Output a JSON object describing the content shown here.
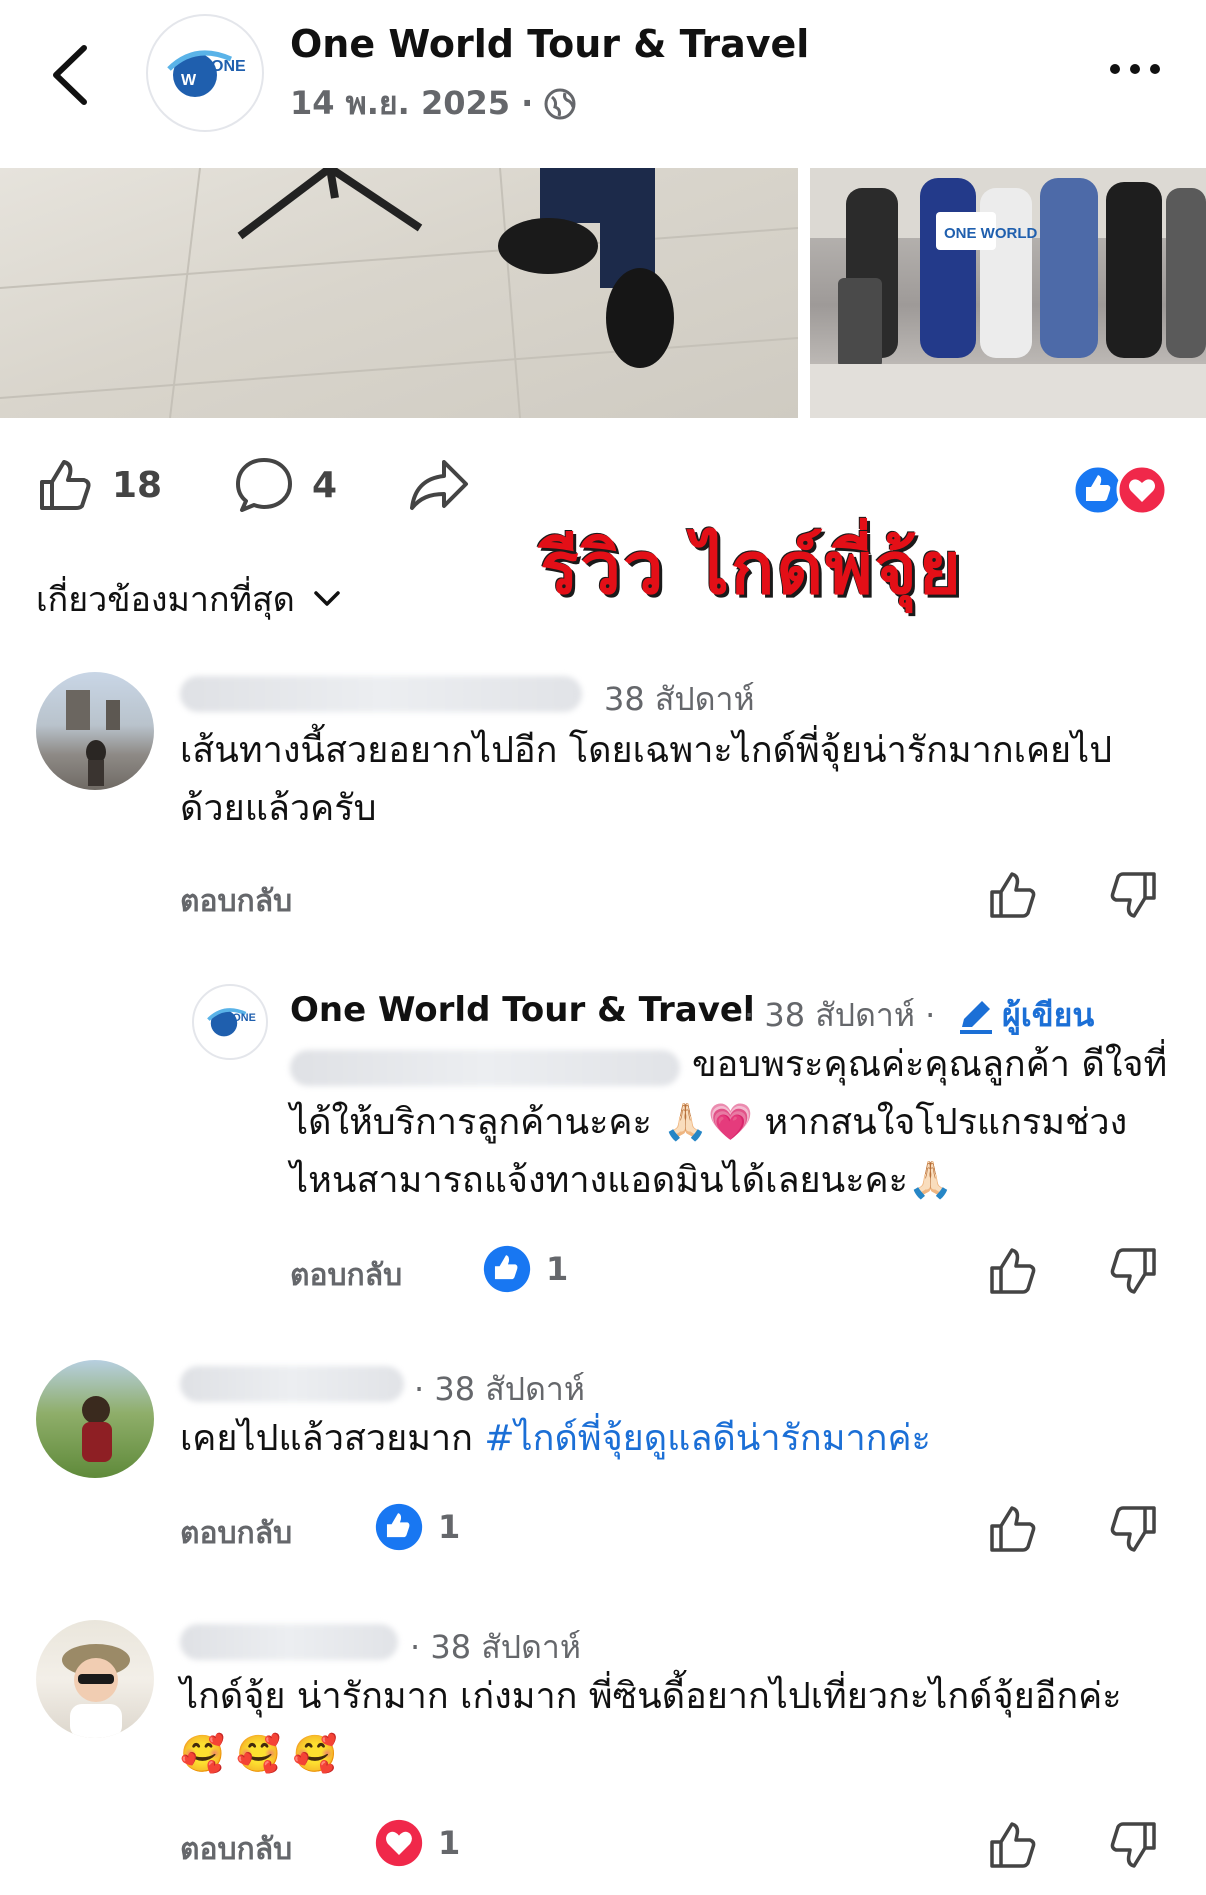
{
  "header": {
    "page_name": "One World Tour & Travel",
    "date": "14 พ.ย. 2025 ·",
    "logo_text": "ONE WORLD"
  },
  "post_photos": {
    "right_sign_text": "ONE WORLD"
  },
  "actions": {
    "like_count": "18",
    "comment_count": "4",
    "reaction_icons": [
      "like-icon",
      "love-icon"
    ]
  },
  "overlay_banner": "รีวิว ไกด์พี่จุ้ย",
  "sort": {
    "label": "เกี่ยวข้องมากที่สุด"
  },
  "comments": [
    {
      "time": "38 สัปดาห์",
      "text": "เส้นทางนี้สวยอยากไปอีก โดยเฉพาะไกด์พี่จุ้ยน่ารักมากเคยไปด้วยแล้วครับ",
      "reply_label": "ตอบกลับ"
    },
    {
      "name": "One World Tour & Travel",
      "time": "· 38 สัปดาห์ ·",
      "author_badge": "ผู้เขียน",
      "text": "ขอบพระคุณค่ะคุณลูกค้า ดีใจที่ได้ให้บริการลูกค้านะคะ 🙏🏻💗 หากสนใจโปรแกรมช่วงไหนสามารถแจ้งทางแอดมินได้เลยนะคะ🙏🏻",
      "reply_label": "ตอบกลับ",
      "reaction_count": "1"
    },
    {
      "time": "· 38 สัปดาห์",
      "text_plain": "เคยไปแล้วสวยมาก ",
      "hashtag": "#ไกด์พี่จุ้ยดูแลดีน่ารักมากค่ะ",
      "reply_label": "ตอบกลับ",
      "reaction_count": "1"
    },
    {
      "time": "· 38 สัปดาห์",
      "text": "ไกด์จุ้ย น่ารักมาก เก่งมาก พี่ซินดี้อยากไปเที่ยวกะไกด์จุ้ยอีกค่ะ 🥰 🥰 🥰",
      "reply_label": "ตอบกลับ",
      "reaction_count": "1"
    }
  ],
  "colors": {
    "like_blue": "#1877f2",
    "love_red": "#f0284a",
    "link_blue": "#1b6fd6",
    "meta_gray": "#65676b"
  }
}
